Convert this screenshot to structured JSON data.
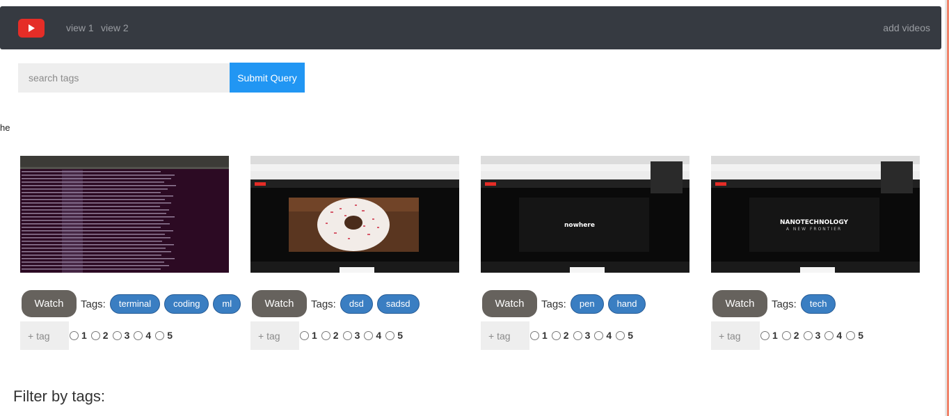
{
  "nav": {
    "logo_icon": "youtube-play-icon",
    "view1": "view 1",
    "view2": "view 2",
    "add_videos": "add videos"
  },
  "search": {
    "placeholder": "search tags",
    "submit_label": "Submit Query"
  },
  "stray_text": "he",
  "cards": [
    {
      "watch_label": "Watch",
      "tags_label": "Tags:",
      "tags": [
        "terminal",
        "coding",
        "ml"
      ],
      "add_tag_placeholder": "+ tag",
      "ratings": [
        "1",
        "2",
        "3",
        "4",
        "5"
      ]
    },
    {
      "watch_label": "Watch",
      "tags_label": "Tags:",
      "tags": [
        "dsd",
        "sadsd"
      ],
      "add_tag_placeholder": "+ tag",
      "ratings": [
        "1",
        "2",
        "3",
        "4",
        "5"
      ]
    },
    {
      "watch_label": "Watch",
      "tags_label": "Tags:",
      "tags": [
        "pen",
        "hand"
      ],
      "add_tag_placeholder": "+ tag",
      "ratings": [
        "1",
        "2",
        "3",
        "4",
        "5"
      ],
      "thumb_text": "nowhere"
    },
    {
      "watch_label": "Watch",
      "tags_label": "Tags:",
      "tags": [
        "tech"
      ],
      "add_tag_placeholder": "+ tag",
      "ratings": [
        "1",
        "2",
        "3",
        "4",
        "5"
      ],
      "thumb_text": "NANOTECHNOLOGY",
      "thumb_subtext": "A NEW FRONTIER"
    }
  ],
  "filter_heading": "Filter by tags:",
  "colors": {
    "navbar": "#363a41",
    "logo_red": "#e52d27",
    "submit_blue": "#2196f3",
    "tag_blue": "#3a7ec2",
    "watch_gray": "#66625d"
  }
}
